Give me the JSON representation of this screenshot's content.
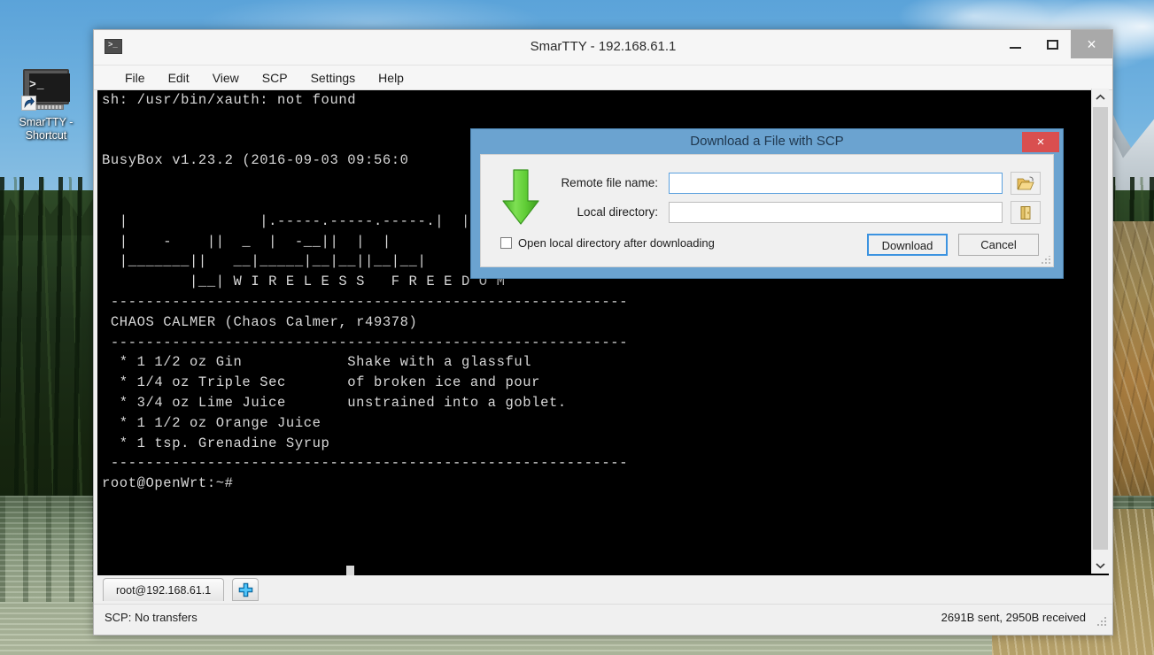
{
  "desktop": {
    "shortcut": {
      "label": "SmarTTY - Shortcut",
      "prompt_glyph": ">_",
      "icon_name": "terminal-monitor-icon"
    }
  },
  "window": {
    "title": "SmarTTY - 192.168.61.1",
    "icon_glyph": ">_",
    "controls": {
      "minimize": "minimize-icon",
      "maximize": "maximize-icon",
      "close": "×"
    },
    "menu": [
      {
        "label": "File"
      },
      {
        "label": "Edit"
      },
      {
        "label": "View"
      },
      {
        "label": "SCP"
      },
      {
        "label": "Settings"
      },
      {
        "label": "Help"
      }
    ]
  },
  "terminal": {
    "content": "sh: /usr/bin/xauth: not found\n\n\nBusyBox v1.23.2 (2016-09-03 09:56:0\n\n\n  |               |.-----.-----.-----.|  |  |\n  |    -    ||  _  |  -__||  |  |\n  |_______||   __|_____|__|__||__|__|\n          |__| W I R E L E S S   F R E E D O M\n -----------------------------------------------------------\n CHAOS CALMER (Chaos Calmer, r49378)\n -----------------------------------------------------------\n  * 1 1/2 oz Gin            Shake with a glassful\n  * 1/4 oz Triple Sec       of broken ice and pour\n  * 3/4 oz Lime Juice       unstrained into a goblet.\n  * 1 1/2 oz Orange Juice\n  * 1 tsp. Grenadine Syrup\n -----------------------------------------------------------\nroot@OpenWrt:~#",
    "lines": [
      "sh: /usr/bin/xauth: not found",
      "BusyBox v1.23.2 (2016-09-03 09:56:0",
      "CHAOS CALMER (Chaos Calmer, r49378)",
      "* 1 1/2 oz Gin            Shake with a glassful",
      "* 1/4 oz Triple Sec       of broken ice and pour",
      "* 3/4 oz Lime Juice       unstrained into a goblet.",
      "* 1 1/2 oz Orange Juice",
      "* 1 tsp. Grenadine Syrup",
      "root@OpenWrt:~#"
    ],
    "prompt": "root@OpenWrt:~#",
    "banner_tagline": "W I R E L E S S   F R E E D O M",
    "background": "#000000",
    "foreground": "#d8d8d8"
  },
  "scrollbar": {
    "up_icon": "chevron-up-icon",
    "down_icon": "chevron-down-icon"
  },
  "tabs": {
    "items": [
      {
        "label": "root@192.168.61.1",
        "active": true
      }
    ],
    "add_label": "add-tab-icon"
  },
  "statusbar": {
    "left": "SCP: No transfers",
    "right": "2691B sent, 2950B received"
  },
  "dialog": {
    "title": "Download a File with SCP",
    "close_glyph": "×",
    "accent_color": "#6ba3d0",
    "close_color": "#d94f4f",
    "arrow_icon": "download-arrow-icon",
    "arrow_color": "#5fc93a",
    "fields": [
      {
        "label": "Remote file name:",
        "value": "",
        "placeholder": "",
        "focused": true,
        "browse_icon": "open-folder-icon"
      },
      {
        "label": "Local directory:",
        "value": "",
        "placeholder": "",
        "focused": false,
        "browse_icon": "folder-icon"
      }
    ],
    "checkbox": {
      "label": "Open local directory after downloading",
      "checked": false
    },
    "buttons": {
      "primary": "Download",
      "secondary": "Cancel"
    }
  }
}
